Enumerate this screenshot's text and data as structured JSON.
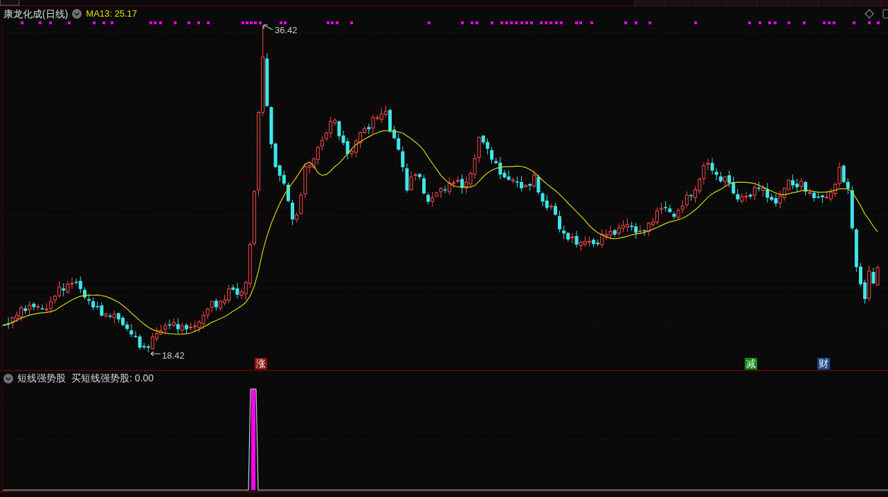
{
  "header": {
    "title": "康龙化成(日线)",
    "indicator": "MA13: 25.17"
  },
  "chart": {
    "price_labels": [
      {
        "kind": "high",
        "text": "36.42"
      },
      {
        "kind": "low",
        "text": "18.42"
      }
    ],
    "markers": [
      {
        "label": "涨",
        "color": "#8e1212"
      },
      {
        "label": "减",
        "color": "#128a12"
      },
      {
        "label": "财",
        "color": "#1d4e8a"
      }
    ]
  },
  "indicator_panel": {
    "name": "短线强势股",
    "reading": "买短线强势股: 0.00"
  }
}
